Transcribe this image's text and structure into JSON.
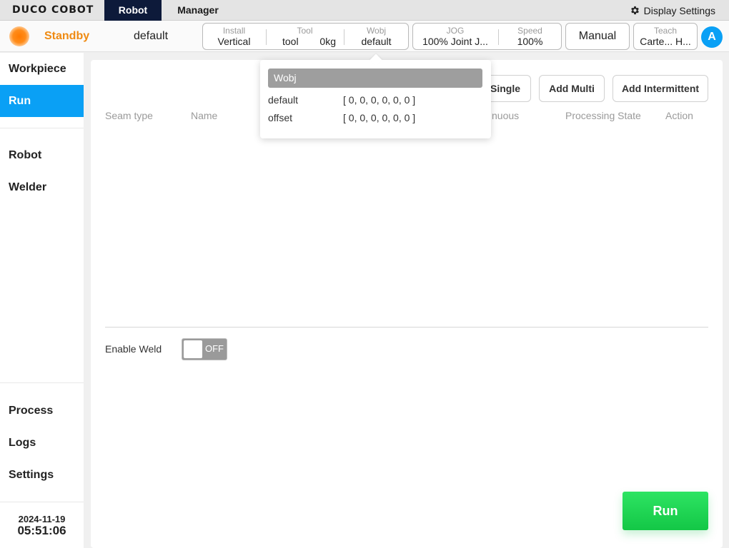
{
  "app": {
    "logo": "DUCO COBOT"
  },
  "menu": {
    "tabs": [
      "Robot",
      "Manager"
    ],
    "display_settings": "Display Settings"
  },
  "status": {
    "state": "Standby",
    "program": "default",
    "install": {
      "label": "Install",
      "value": "Vertical"
    },
    "tool": {
      "label": "Tool",
      "name": "tool",
      "load": "0kg"
    },
    "wobj": {
      "label": "Wobj",
      "value": "default"
    },
    "jog": {
      "label": "JOG",
      "value": "100% Joint J..."
    },
    "speed": {
      "label": "Speed",
      "value": "100%"
    },
    "mode": "Manual",
    "teach": {
      "label": "Teach",
      "value": "Carte... H..."
    },
    "user_initial": "A"
  },
  "sidebar": {
    "top": [
      {
        "label": "Workpiece"
      },
      {
        "label": "Run"
      }
    ],
    "middle": [
      {
        "label": "Robot"
      },
      {
        "label": "Welder"
      }
    ],
    "bottom": [
      {
        "label": "Process"
      },
      {
        "label": "Logs"
      },
      {
        "label": "Settings"
      }
    ],
    "date": "2024-11-19",
    "time": "05:51:06"
  },
  "main": {
    "buttons": {
      "add_single": "Single",
      "add_multi": "Add Multi",
      "add_intermittent": "Add Intermittent"
    },
    "columns": [
      "Seam type",
      "Name",
      "nuous",
      "Processing State",
      "Action"
    ],
    "enable_weld": "Enable Weld",
    "toggle_state": "OFF",
    "run": "Run"
  },
  "popup": {
    "title": "Wobj",
    "rows": [
      {
        "name": "default",
        "value": "[ 0, 0, 0, 0, 0, 0 ]"
      },
      {
        "name": "offset",
        "value": "[ 0, 0, 0, 0, 0, 0 ]"
      }
    ]
  },
  "colors": {
    "accent": "#0aa0f5",
    "standby": "#ef8a12",
    "run": "#1dd655",
    "nav_dark": "#0d1a3a"
  }
}
